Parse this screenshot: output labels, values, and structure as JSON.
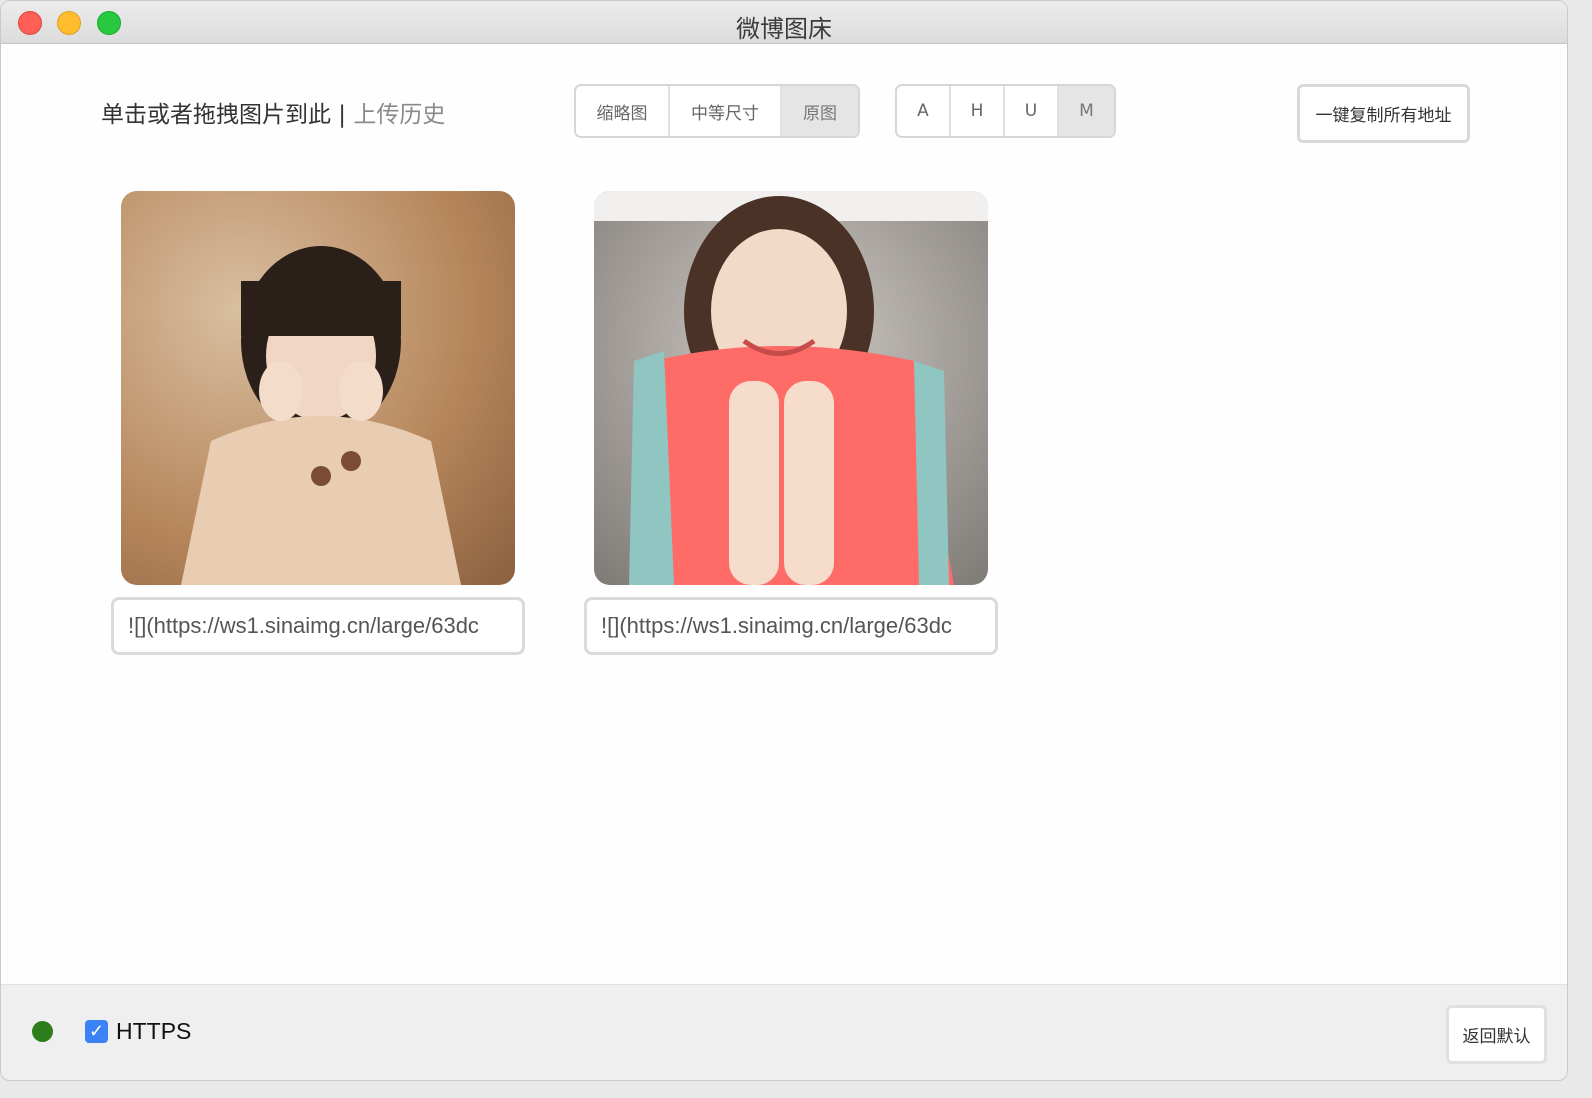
{
  "window": {
    "title": "微博图床"
  },
  "toolbar": {
    "instruction": "单击或者拖拽图片到此",
    "separator": " | ",
    "history_link": "上传历史",
    "size_options": [
      "缩略图",
      "中等尺寸",
      "原图"
    ],
    "size_selected": "原图",
    "format_options": [
      "A",
      "H",
      "U",
      "M"
    ],
    "format_selected": "M",
    "copy_all_label": "一键复制所有地址"
  },
  "images": [
    {
      "url_value": "![](https://ws1.sinaimg.cn/large/63dc"
    },
    {
      "url_value": "![](https://ws1.sinaimg.cn/large/63dc"
    }
  ],
  "footer": {
    "https_label": "HTTPS",
    "https_checked": true,
    "status_color": "#2e7d1b",
    "reset_label": "返回默认"
  }
}
